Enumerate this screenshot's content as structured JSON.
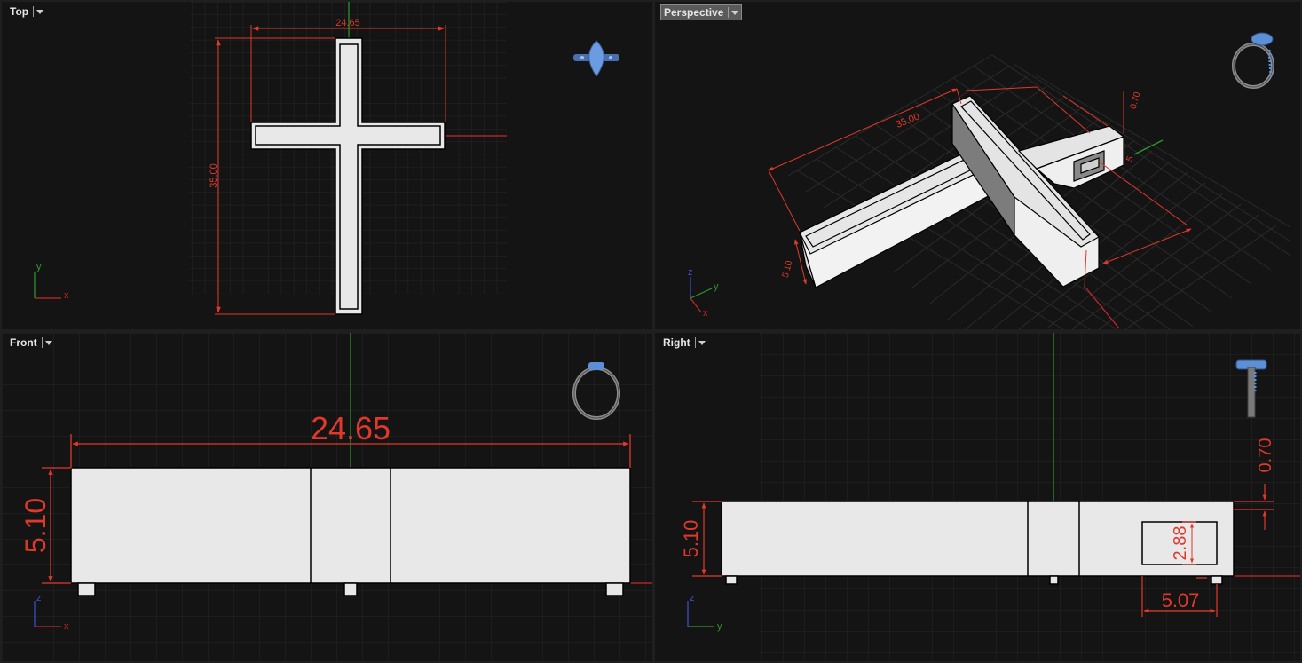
{
  "viewports": {
    "top": {
      "label": "Top"
    },
    "persp": {
      "label": "Perspective",
      "active": true
    },
    "front": {
      "label": "Front"
    },
    "right": {
      "label": "Right"
    }
  },
  "dimensions": {
    "top": {
      "width": "24.65",
      "height": "35.00"
    },
    "persp": {
      "length": "35.00",
      "wall": "0.70",
      "depth": "5.10",
      "hole": "5"
    },
    "front": {
      "width": "24.65",
      "depth": "5.10"
    },
    "right": {
      "wall": "0.70",
      "depth": "5.10",
      "hole_h": "2.88",
      "hole_w": "5.07"
    }
  },
  "axes": {
    "x": "x",
    "y": "y",
    "z": "z"
  },
  "icons": {
    "nav_cube": "ring-orientation-icon"
  },
  "colors": {
    "viewport_bg": "#141414",
    "grid": "#2a2a2a",
    "dimension": "#e0392b",
    "x_axis": "#c62828",
    "y_axis": "#2e9b2e",
    "z_axis": "#3b52d9",
    "object_fill": "#e8e8e8",
    "ring_accent": "#5b8fd6"
  }
}
